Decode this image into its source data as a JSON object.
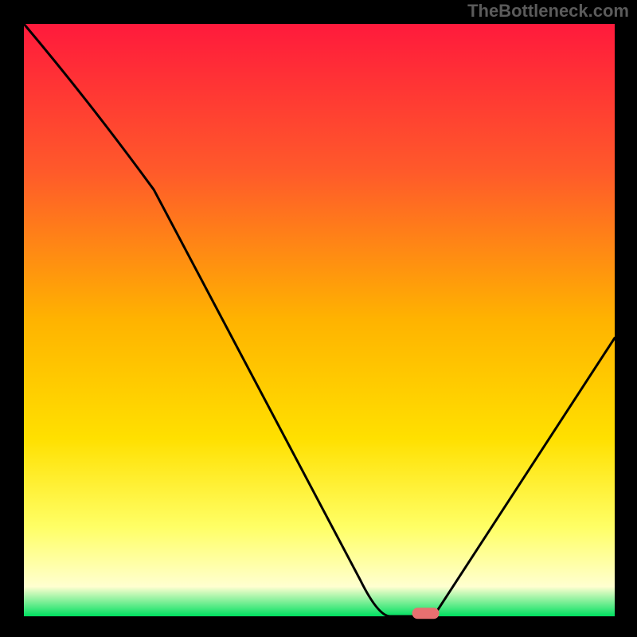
{
  "watermark": "TheBottleneck.com",
  "chart_data": {
    "type": "line",
    "title": "",
    "xlabel": "",
    "ylabel": "",
    "xlim": [
      0,
      100
    ],
    "ylim": [
      0,
      100
    ],
    "x": [
      0,
      22,
      62,
      66,
      70,
      100
    ],
    "values": [
      100,
      72,
      0,
      0,
      1,
      47
    ],
    "marker": {
      "x": 68,
      "y": 0.5
    },
    "gradient_stops": [
      {
        "offset": 0,
        "color": "#ff1a3c"
      },
      {
        "offset": 25,
        "color": "#ff5a2a"
      },
      {
        "offset": 50,
        "color": "#ffb300"
      },
      {
        "offset": 70,
        "color": "#ffe000"
      },
      {
        "offset": 85,
        "color": "#ffff66"
      },
      {
        "offset": 95,
        "color": "#ffffd0"
      },
      {
        "offset": 100,
        "color": "#00e060"
      }
    ],
    "colors": {
      "frame": "#000000",
      "curve": "#000000",
      "marker": "#e87070"
    }
  }
}
